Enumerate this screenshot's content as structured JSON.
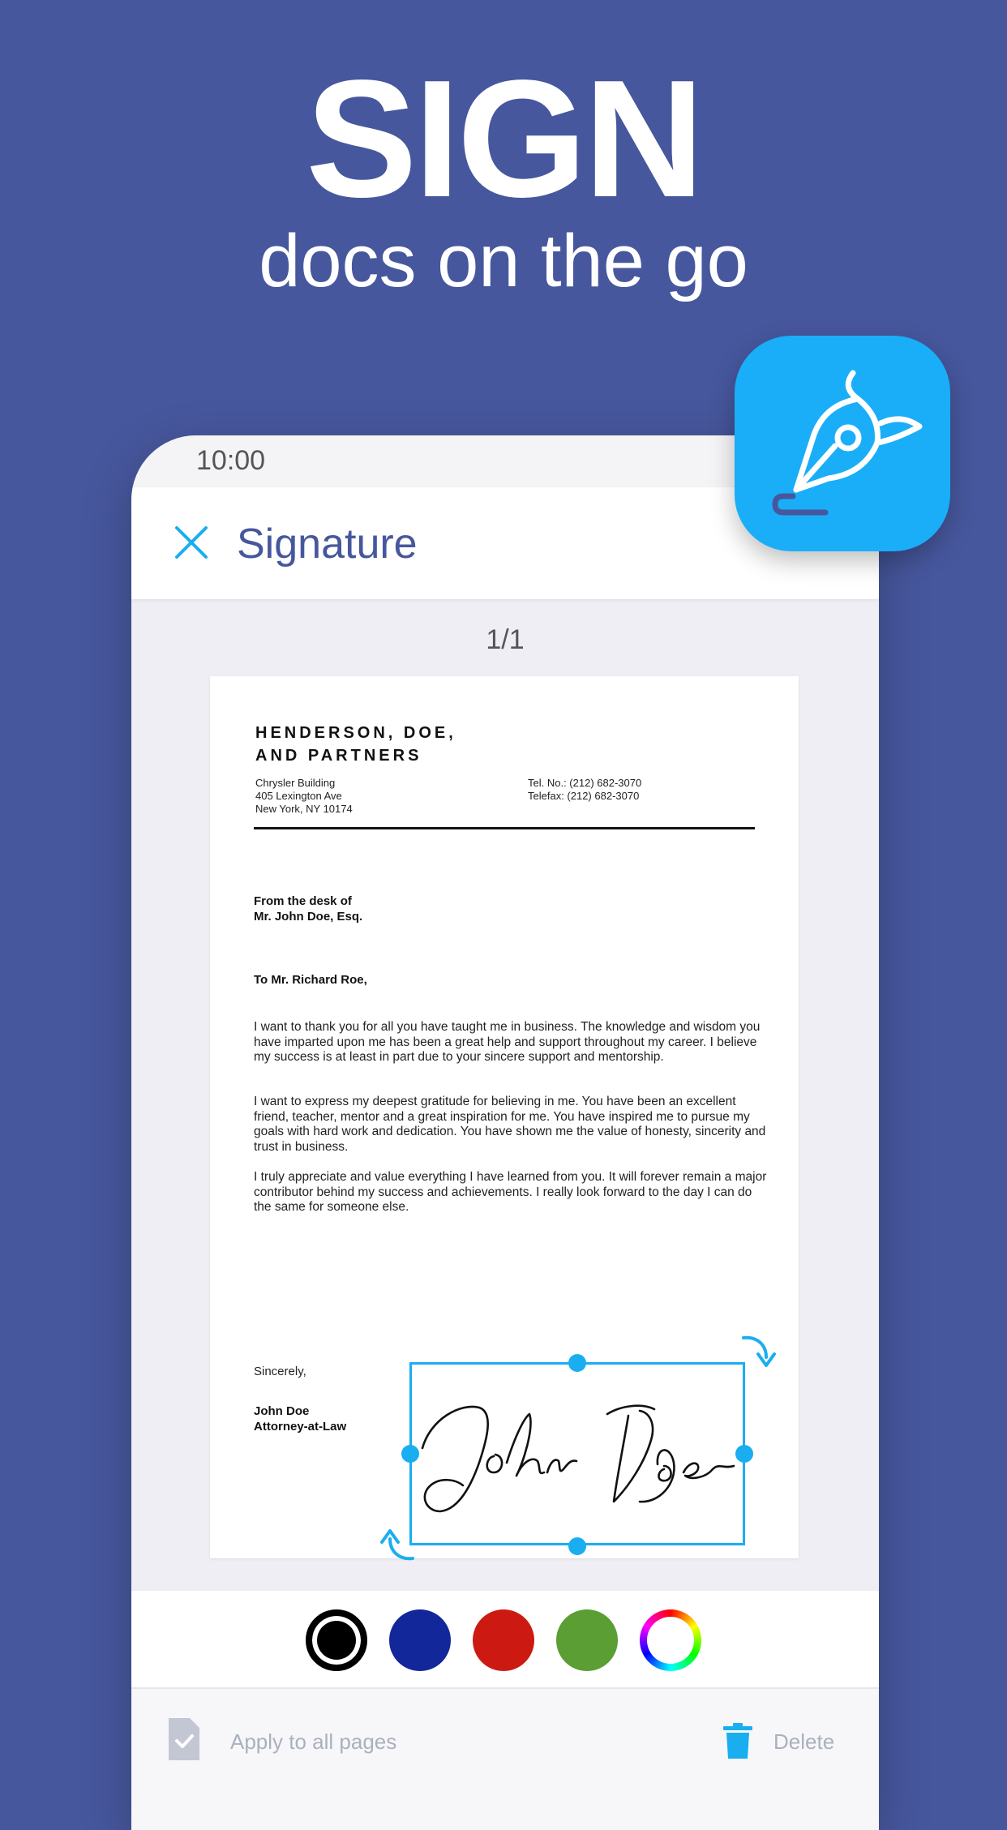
{
  "hero": {
    "headline": "SIGN",
    "subline": "docs on the go"
  },
  "status_bar": {
    "time": "10:00"
  },
  "header": {
    "title": "Signature"
  },
  "page_indicator": "1/1",
  "document": {
    "firm_line1": "HENDERSON, DOE,",
    "firm_line2": "AND PARTNERS",
    "address": [
      "Chrysler Building",
      "405 Lexington Ave",
      "New York, NY 10174"
    ],
    "contact": [
      "Tel. No.: (212) 682-3070",
      "Telefax: (212) 682-3070"
    ],
    "from_line1": "From the desk of",
    "from_line2": "Mr. John Doe, Esq.",
    "salutation": "To Mr. Richard Roe,",
    "paragraphs": [
      "I want to thank you for all you have taught me in business. The knowledge and wisdom you have imparted upon me has been a great help and support throughout my career. I believe my success is at least in part due to your sincere support and mentorship.",
      "I want to express my deepest gratitude for believing in me. You have been an excellent friend, teacher, mentor and a great inspiration for me. You have inspired me to pursue my goals with hard work and dedication. You have shown me the value of honesty, sincerity and trust in business.",
      "I truly appreciate and value everything I have learned from you. It will forever remain a major contributor behind my success and achievements. I really look forward to the day I can do the same for someone else."
    ],
    "closing": "Sincerely,",
    "signer_name": "John Doe",
    "signer_title": "Attorney-at-Law"
  },
  "palette": {
    "selected": "black",
    "colors": [
      "#000000",
      "#12279a",
      "#cc1a12",
      "#5a9e34"
    ]
  },
  "actions": {
    "apply_all": "Apply to all pages",
    "delete": "Delete"
  },
  "colors": {
    "background": "#47579d",
    "accent": "#1aaef0",
    "title": "#47579d"
  }
}
